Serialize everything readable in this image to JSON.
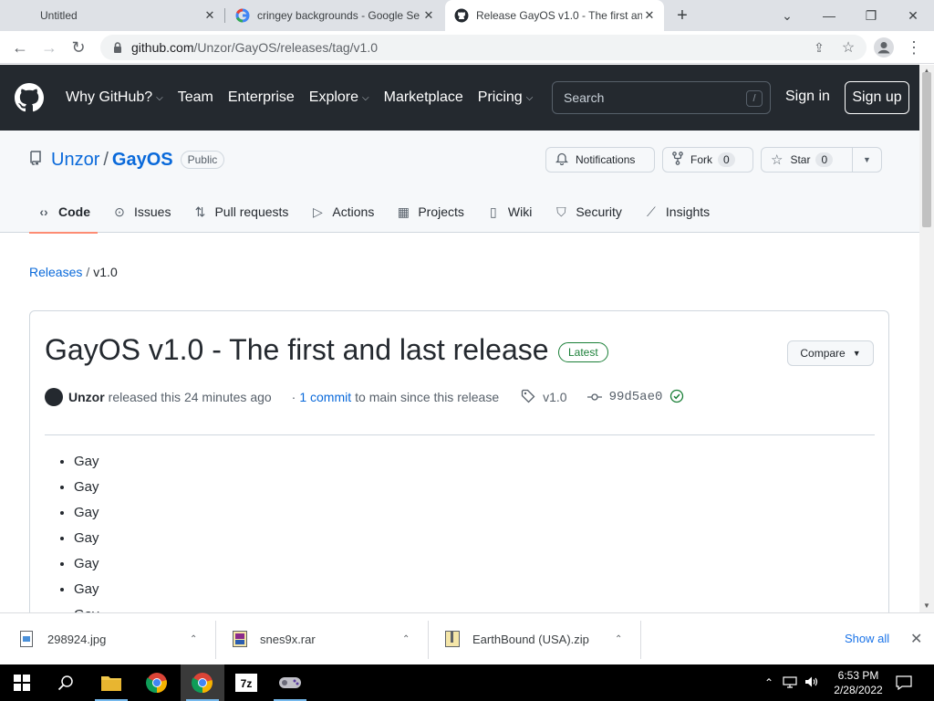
{
  "browser": {
    "tabs": [
      {
        "title": "Untitled"
      },
      {
        "title": "cringey backgrounds - Google Se"
      },
      {
        "title": "Release GayOS v1.0 - The first an"
      }
    ],
    "url_host": "github.com",
    "url_path": "/Unzor/GayOS/releases/tag/v1.0"
  },
  "gh_header": {
    "nav": [
      "Why GitHub?",
      "Team",
      "Enterprise",
      "Explore",
      "Marketplace",
      "Pricing"
    ],
    "search_placeholder": "Search",
    "search_key": "/",
    "signin": "Sign in",
    "signup": "Sign up"
  },
  "repo": {
    "owner": "Unzor",
    "name": "GayOS",
    "visibility": "Public",
    "notifications": "Notifications",
    "fork_label": "Fork",
    "fork_count": "0",
    "star_label": "Star",
    "star_count": "0",
    "tabs": [
      "Code",
      "Issues",
      "Pull requests",
      "Actions",
      "Projects",
      "Wiki",
      "Security",
      "Insights"
    ]
  },
  "breadcrumb": {
    "releases": "Releases",
    "sep": "/",
    "current": "v1.0"
  },
  "release": {
    "title": "GayOS v1.0 - The first and last release",
    "badge": "Latest",
    "compare": "Compare",
    "author": "Unzor",
    "released_text": "released this 24 minutes ago",
    "commits_prefix": "·",
    "commits_link": "1 commit",
    "commits_suffix": "to main since this release",
    "tag": "v1.0",
    "sha": "99d5ae0",
    "notes": [
      "Gay",
      "Gay",
      "Gay",
      "Gay",
      "Gay",
      "Gay",
      "Gay"
    ]
  },
  "downloads": {
    "items": [
      {
        "name": "298924.jpg"
      },
      {
        "name": "snes9x.rar"
      },
      {
        "name": "EarthBound (USA).zip"
      }
    ],
    "show_all": "Show all"
  },
  "taskbar": {
    "time": "6:53 PM",
    "date": "2/28/2022"
  },
  "colors": {
    "gh_header_bg": "#24292f",
    "link": "#0969da",
    "latest_green": "#1a7f37",
    "tab_underline": "#fd8c73"
  }
}
